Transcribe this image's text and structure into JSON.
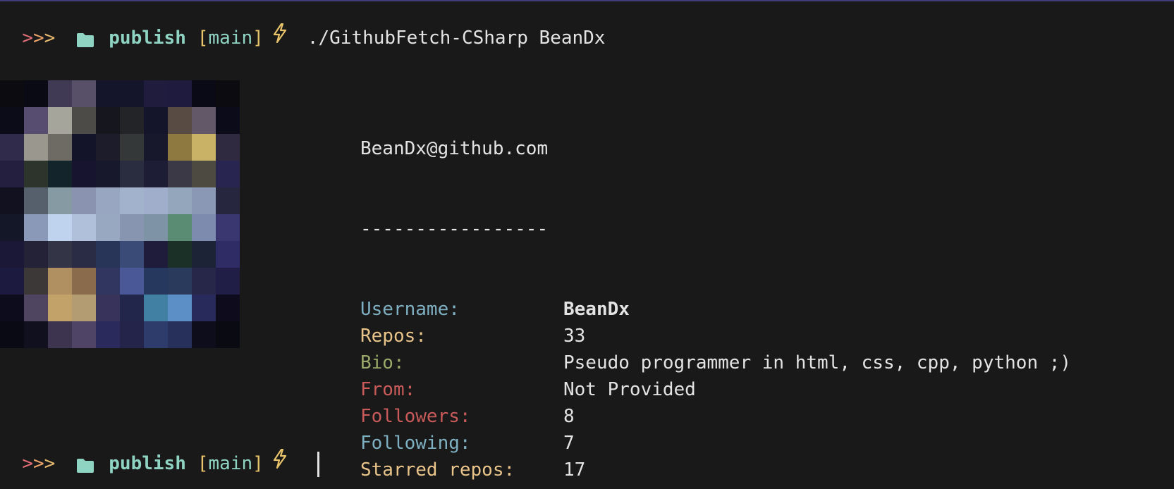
{
  "prompt": {
    "arrows": ">>>",
    "directory": "publish",
    "branch_open": "[",
    "branch": "main",
    "branch_close": "]",
    "icons": [
      "folder-icon",
      "lightning-bolt-icon"
    ],
    "colors": {
      "arrow_red": "#e06c75",
      "arrow_orange": "#e8a26a",
      "directory": "#8fd3c2",
      "branch_bracket": "#e9c46a",
      "bolt": "#e9c46a"
    }
  },
  "command": {
    "text": "./GithubFetch-CSharp BeanDx"
  },
  "output": {
    "header": "BeanDx@github.com",
    "separator": "-----------------",
    "fields": [
      {
        "label": "Username:",
        "value": "BeanDx",
        "label_color": "#7fb0c2"
      },
      {
        "label": "Repos:",
        "value": "33",
        "label_color": "#e9c48a"
      },
      {
        "label": "Bio:",
        "value": "Pseudo programmer in html, css, cpp, python ;)",
        "label_color": "#9aa86a"
      },
      {
        "label": "From:",
        "value": "Not Provided",
        "label_color": "#c85a5a"
      },
      {
        "label": "Followers:",
        "value": "8",
        "label_color": "#c85a5a"
      },
      {
        "label": "Following:",
        "value": "7",
        "label_color": "#7fb0c2"
      },
      {
        "label": "Starred repos:",
        "value": "17",
        "label_color": "#e9c48a"
      }
    ]
  },
  "avatar": {
    "pixels": [
      "#0b0b10",
      "#0a0a14",
      "#403a55",
      "#575068",
      "#14142a",
      "#14142a",
      "#1f1c3d",
      "#1e1b3f",
      "#0a0a17",
      "#0b0b10",
      "#0c0b18",
      "#564d70",
      "#a6a59c",
      "#4c4b47",
      "#16161e",
      "#232427",
      "#14142a",
      "#574b44",
      "#625868",
      "#0b0b1a",
      "#302b4a",
      "#9a978e",
      "#6e6b64",
      "#13142a",
      "#1c1c2a",
      "#343838",
      "#17182c",
      "#8e7a40",
      "#c9b166",
      "#2f2a3f",
      "#241f3e",
      "#2d342c",
      "#14242b",
      "#16142e",
      "#18182c",
      "#2a2c3f",
      "#1d1d35",
      "#3b3945",
      "#4d4a41",
      "#282650",
      "#12111f",
      "#565f6c",
      "#869aa4",
      "#8a93b0",
      "#98a6c2",
      "#a2b2cc",
      "#a0aecb",
      "#93a6bb",
      "#8a98b6",
      "#27263f",
      "#141728",
      "#8a99b8",
      "#bfd3ee",
      "#b0bfda",
      "#97a8c0",
      "#8895b0",
      "#7e94a6",
      "#598c72",
      "#7d8cae",
      "#3a3770",
      "#1a1836",
      "#232236",
      "#343447",
      "#2a2b45",
      "#283558",
      "#3b4b78",
      "#1f1b3a",
      "#1b3027",
      "#1d2337",
      "#2f2b64",
      "#1d1a3f",
      "#3d3838",
      "#b09060",
      "#8a6c4d",
      "#303660",
      "#4a5898",
      "#27385e",
      "#2a3a5c",
      "#272849",
      "#201e46",
      "#0d0c1c",
      "#4f4560",
      "#c2a268",
      "#b39b72",
      "#38335a",
      "#22264a",
      "#4280a3",
      "#5b8fc6",
      "#292a5c",
      "#0e0c1c",
      "#0a0a14",
      "#10101f",
      "#3d3550",
      "#504466",
      "#2b2a5c",
      "#24234a",
      "#2d3c6b",
      "#27305b",
      "#0e0d1c",
      "#0a0a12"
    ]
  }
}
